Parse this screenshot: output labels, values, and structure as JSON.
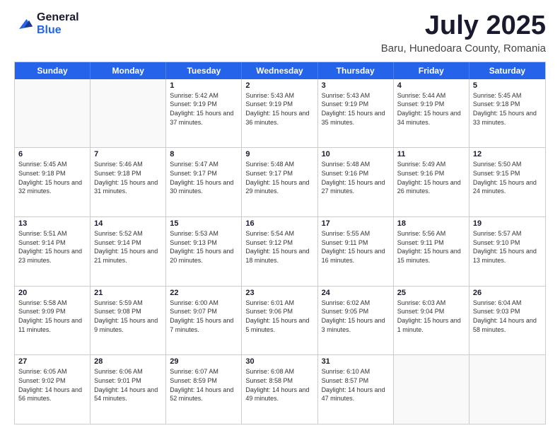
{
  "logo": {
    "general": "General",
    "blue": "Blue"
  },
  "title": {
    "month": "July 2025",
    "location": "Baru, Hunedoara County, Romania"
  },
  "calendar": {
    "days_of_week": [
      "Sunday",
      "Monday",
      "Tuesday",
      "Wednesday",
      "Thursday",
      "Friday",
      "Saturday"
    ],
    "weeks": [
      [
        {
          "day": "",
          "empty": true
        },
        {
          "day": "",
          "empty": true
        },
        {
          "day": "1",
          "sunrise": "5:42 AM",
          "sunset": "9:19 PM",
          "daylight": "15 hours and 37 minutes."
        },
        {
          "day": "2",
          "sunrise": "5:43 AM",
          "sunset": "9:19 PM",
          "daylight": "15 hours and 36 minutes."
        },
        {
          "day": "3",
          "sunrise": "5:43 AM",
          "sunset": "9:19 PM",
          "daylight": "15 hours and 35 minutes."
        },
        {
          "day": "4",
          "sunrise": "5:44 AM",
          "sunset": "9:19 PM",
          "daylight": "15 hours and 34 minutes."
        },
        {
          "day": "5",
          "sunrise": "5:45 AM",
          "sunset": "9:18 PM",
          "daylight": "15 hours and 33 minutes."
        }
      ],
      [
        {
          "day": "6",
          "sunrise": "5:45 AM",
          "sunset": "9:18 PM",
          "daylight": "15 hours and 32 minutes."
        },
        {
          "day": "7",
          "sunrise": "5:46 AM",
          "sunset": "9:18 PM",
          "daylight": "15 hours and 31 minutes."
        },
        {
          "day": "8",
          "sunrise": "5:47 AM",
          "sunset": "9:17 PM",
          "daylight": "15 hours and 30 minutes."
        },
        {
          "day": "9",
          "sunrise": "5:48 AM",
          "sunset": "9:17 PM",
          "daylight": "15 hours and 29 minutes."
        },
        {
          "day": "10",
          "sunrise": "5:48 AM",
          "sunset": "9:16 PM",
          "daylight": "15 hours and 27 minutes."
        },
        {
          "day": "11",
          "sunrise": "5:49 AM",
          "sunset": "9:16 PM",
          "daylight": "15 hours and 26 minutes."
        },
        {
          "day": "12",
          "sunrise": "5:50 AM",
          "sunset": "9:15 PM",
          "daylight": "15 hours and 24 minutes."
        }
      ],
      [
        {
          "day": "13",
          "sunrise": "5:51 AM",
          "sunset": "9:14 PM",
          "daylight": "15 hours and 23 minutes."
        },
        {
          "day": "14",
          "sunrise": "5:52 AM",
          "sunset": "9:14 PM",
          "daylight": "15 hours and 21 minutes."
        },
        {
          "day": "15",
          "sunrise": "5:53 AM",
          "sunset": "9:13 PM",
          "daylight": "15 hours and 20 minutes."
        },
        {
          "day": "16",
          "sunrise": "5:54 AM",
          "sunset": "9:12 PM",
          "daylight": "15 hours and 18 minutes."
        },
        {
          "day": "17",
          "sunrise": "5:55 AM",
          "sunset": "9:11 PM",
          "daylight": "15 hours and 16 minutes."
        },
        {
          "day": "18",
          "sunrise": "5:56 AM",
          "sunset": "9:11 PM",
          "daylight": "15 hours and 15 minutes."
        },
        {
          "day": "19",
          "sunrise": "5:57 AM",
          "sunset": "9:10 PM",
          "daylight": "15 hours and 13 minutes."
        }
      ],
      [
        {
          "day": "20",
          "sunrise": "5:58 AM",
          "sunset": "9:09 PM",
          "daylight": "15 hours and 11 minutes."
        },
        {
          "day": "21",
          "sunrise": "5:59 AM",
          "sunset": "9:08 PM",
          "daylight": "15 hours and 9 minutes."
        },
        {
          "day": "22",
          "sunrise": "6:00 AM",
          "sunset": "9:07 PM",
          "daylight": "15 hours and 7 minutes."
        },
        {
          "day": "23",
          "sunrise": "6:01 AM",
          "sunset": "9:06 PM",
          "daylight": "15 hours and 5 minutes."
        },
        {
          "day": "24",
          "sunrise": "6:02 AM",
          "sunset": "9:05 PM",
          "daylight": "15 hours and 3 minutes."
        },
        {
          "day": "25",
          "sunrise": "6:03 AM",
          "sunset": "9:04 PM",
          "daylight": "15 hours and 1 minute."
        },
        {
          "day": "26",
          "sunrise": "6:04 AM",
          "sunset": "9:03 PM",
          "daylight": "14 hours and 58 minutes."
        }
      ],
      [
        {
          "day": "27",
          "sunrise": "6:05 AM",
          "sunset": "9:02 PM",
          "daylight": "14 hours and 56 minutes."
        },
        {
          "day": "28",
          "sunrise": "6:06 AM",
          "sunset": "9:01 PM",
          "daylight": "14 hours and 54 minutes."
        },
        {
          "day": "29",
          "sunrise": "6:07 AM",
          "sunset": "8:59 PM",
          "daylight": "14 hours and 52 minutes."
        },
        {
          "day": "30",
          "sunrise": "6:08 AM",
          "sunset": "8:58 PM",
          "daylight": "14 hours and 49 minutes."
        },
        {
          "day": "31",
          "sunrise": "6:10 AM",
          "sunset": "8:57 PM",
          "daylight": "14 hours and 47 minutes."
        },
        {
          "day": "",
          "empty": true
        },
        {
          "day": "",
          "empty": true
        }
      ]
    ]
  }
}
